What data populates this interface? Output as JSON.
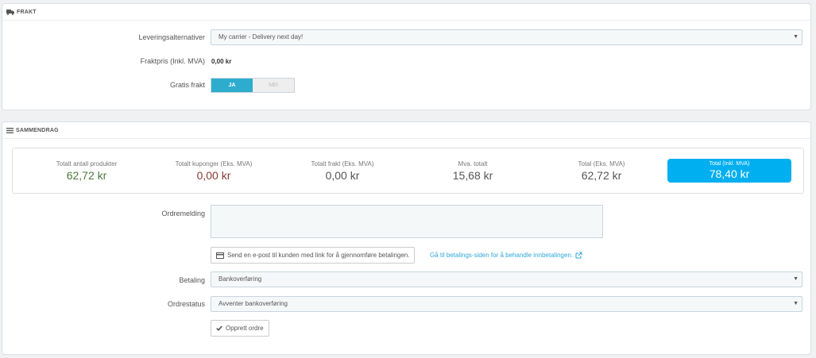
{
  "shipping": {
    "header": "FRAKT",
    "icon": "truck-icon",
    "carrier_label": "Leveringsalternativer",
    "carrier_value": "My carrier - Delivery next day!",
    "price_label": "Fraktpris (Inkl. MVA)",
    "price_value": "0,00 kr",
    "free_label": "Gratis frakt",
    "free_yes": "JA",
    "free_no": "NEI"
  },
  "summary": {
    "header": "SAMMENDRAG",
    "icon": "list-icon",
    "items": [
      {
        "title": "Totalt antall produkter",
        "value": "62,72 kr"
      },
      {
        "title": "Totalt kuponger (Eks. MVA)",
        "value": "0,00 kr"
      },
      {
        "title": "Totalt frakt (Eks. MVA)",
        "value": "0,00 kr"
      },
      {
        "title": "Mva. totalt",
        "value": "15,68 kr"
      },
      {
        "title": "Total (Eks. MVA)",
        "value": "62,72 kr"
      },
      {
        "title": "Total (Inkl. MVA)",
        "value": "78,40 kr"
      }
    ],
    "order_message_label": "Ordremelding",
    "send_email_button": "Send en e-post til kunden med link for å gjennomføre betalingen.",
    "payment_page_link": "Gå til betalings-siden for å behandle innbetalingen.",
    "payment_label": "Betaling",
    "payment_value": "Bankoverføring",
    "status_label": "Ordrestatus",
    "status_value": "Avventer bankoverføring",
    "create_button": "Opprett ordre"
  },
  "colors": {
    "accent": "#00aff0",
    "switch_on": "#2eacce",
    "link": "#2fa7d8",
    "value_green": "#4a7a3c",
    "value_red": "#8a3a33"
  }
}
